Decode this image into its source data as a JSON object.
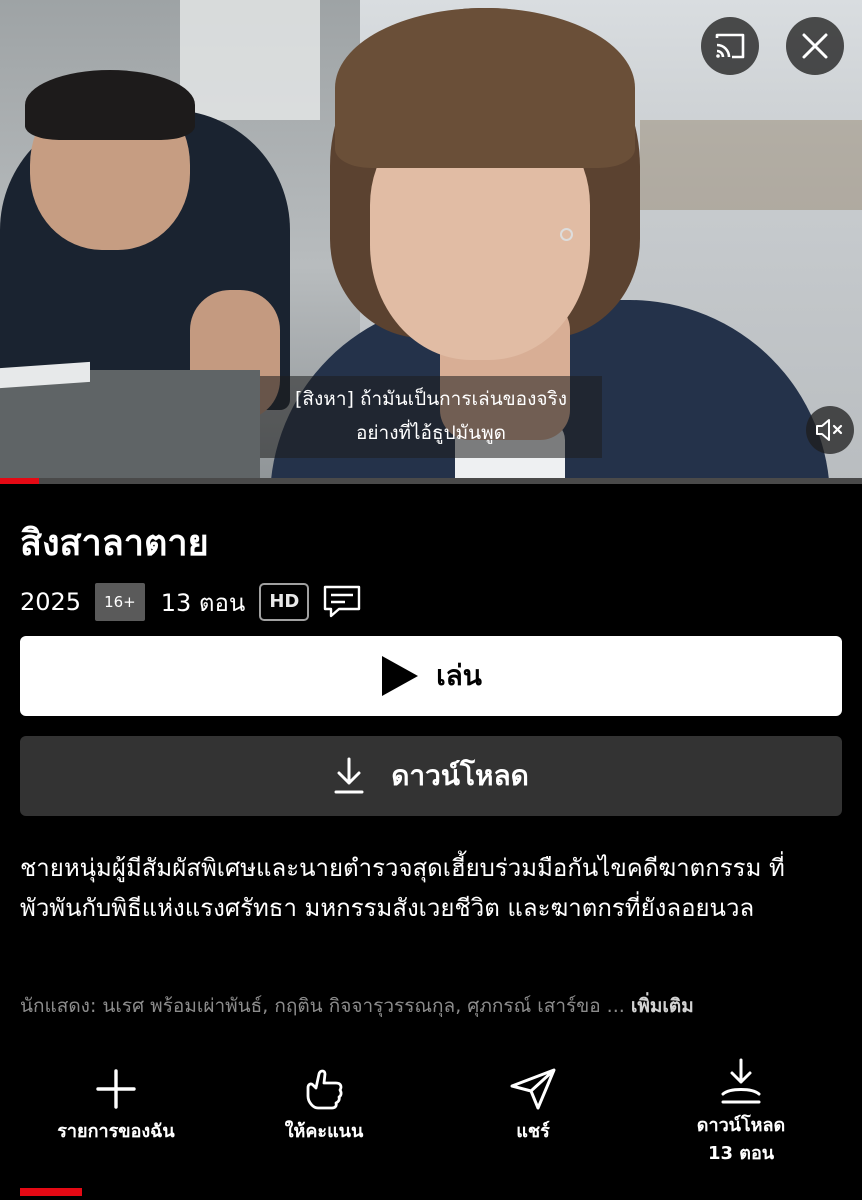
{
  "player": {
    "subtitle_lines": [
      "[สิงหา] ถ้ามันเป็นการเล่นของจริง",
      "อย่างที่ไอ้ธูปมันพูด"
    ],
    "progress_fraction": 0.045,
    "icons": {
      "cast": "cast-icon",
      "close": "close-icon",
      "mute": "volume-muted-icon"
    }
  },
  "show": {
    "title": "สิงสาลาตาย",
    "year": "2025",
    "maturity_rating": "16+",
    "episode_count": "13 ตอน",
    "quality": "HD",
    "subtitles_icon": "subtitles-icon"
  },
  "buttons": {
    "play_label": "เล่น",
    "download_label": "ดาวน์โหลด"
  },
  "synopsis": "ชายหนุ่มผู้มีสัมผัสพิเศษและนายตำรวจสุดเฮี้ยบร่วมมือกันไขคดีฆาตกรรม ที่พัวพันกับพิธีแห่งแรงศรัทธา มหกรรมสังเวยชีวิต และฆาตกรที่ยังลอยนวล",
  "cast": {
    "text": "นักแสดง: นเรศ พร้อมเผ่าพันธ์, กฤติน กิจจารุวรรณกุล, ศุภกรณ์ เสาร์ขอ",
    "ellipsis": "...",
    "more_label": "เพิ่มเติม"
  },
  "actions": [
    {
      "label": "รายการของฉัน",
      "icon": "plus-icon"
    },
    {
      "label": "ให้คะแนน",
      "icon": "thumbs-up-icon"
    },
    {
      "label": "แชร์",
      "icon": "send-icon"
    },
    {
      "label": "ดาวน์โหลด",
      "sublabel": "13 ตอน",
      "icon": "download-all-icon"
    }
  ],
  "colors": {
    "accent": "#e50914",
    "background": "#000000",
    "secondary_button": "#333333",
    "cast_text": "#8c8c8c"
  }
}
